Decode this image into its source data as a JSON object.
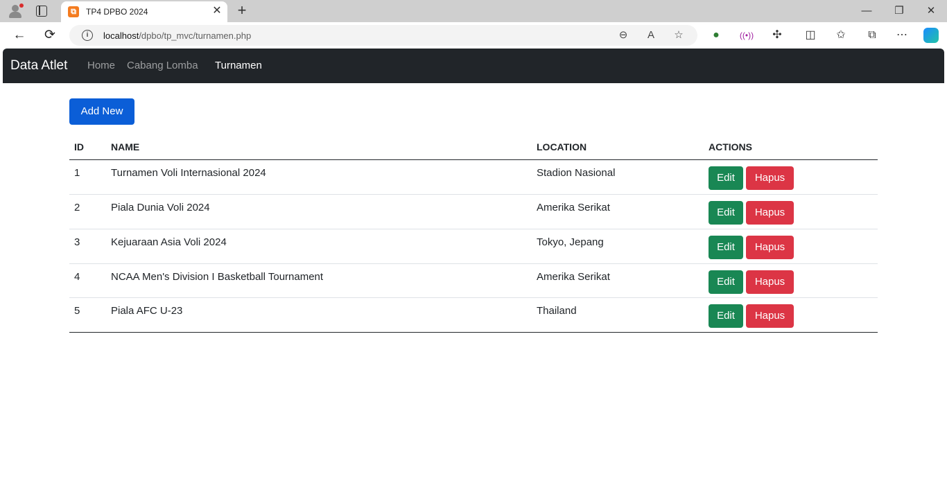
{
  "browser": {
    "tab_title": "TP4 DPBO 2024",
    "favicon_glyph": "⧉",
    "url_host": "localhost",
    "url_path": "/dpbo/tp_mvc/turnamen.php"
  },
  "icons": {
    "close": "✕",
    "plus": "+",
    "minimize": "—",
    "restore": "❐",
    "back": "←",
    "refresh": "⟳",
    "info": "i",
    "zoom": "⊖",
    "read_aloud": "A",
    "favorite": "☆",
    "extensions": "✣",
    "split": "◫",
    "favorites": "✩",
    "collections": "⧉",
    "more": "⋯"
  },
  "navbar": {
    "brand": "Data Atlet",
    "links": [
      {
        "label": "Home",
        "active": false
      },
      {
        "label": "Cabang Lomba",
        "active": false
      },
      {
        "label": "Turnamen",
        "active": true
      }
    ]
  },
  "page": {
    "add_button": "Add New",
    "edit_label": "Edit",
    "delete_label": "Hapus",
    "headers": {
      "id": "ID",
      "name": "NAME",
      "location": "LOCATION",
      "actions": "ACTIONS"
    },
    "rows": [
      {
        "id": "1",
        "name": "Turnamen Voli Internasional 2024",
        "location": "Stadion Nasional"
      },
      {
        "id": "2",
        "name": "Piala Dunia Voli 2024",
        "location": "Amerika Serikat"
      },
      {
        "id": "3",
        "name": "Kejuaraan Asia Voli 2024",
        "location": "Tokyo, Jepang"
      },
      {
        "id": "4",
        "name": "NCAA Men's Division I Basketball Tournament",
        "location": "Amerika Serikat"
      },
      {
        "id": "5",
        "name": "Piala AFC U-23",
        "location": "Thailand"
      }
    ]
  },
  "colors": {
    "navbar_bg": "#212529",
    "primary": "#0b5ed7",
    "success": "#198754",
    "danger": "#dc3545"
  }
}
